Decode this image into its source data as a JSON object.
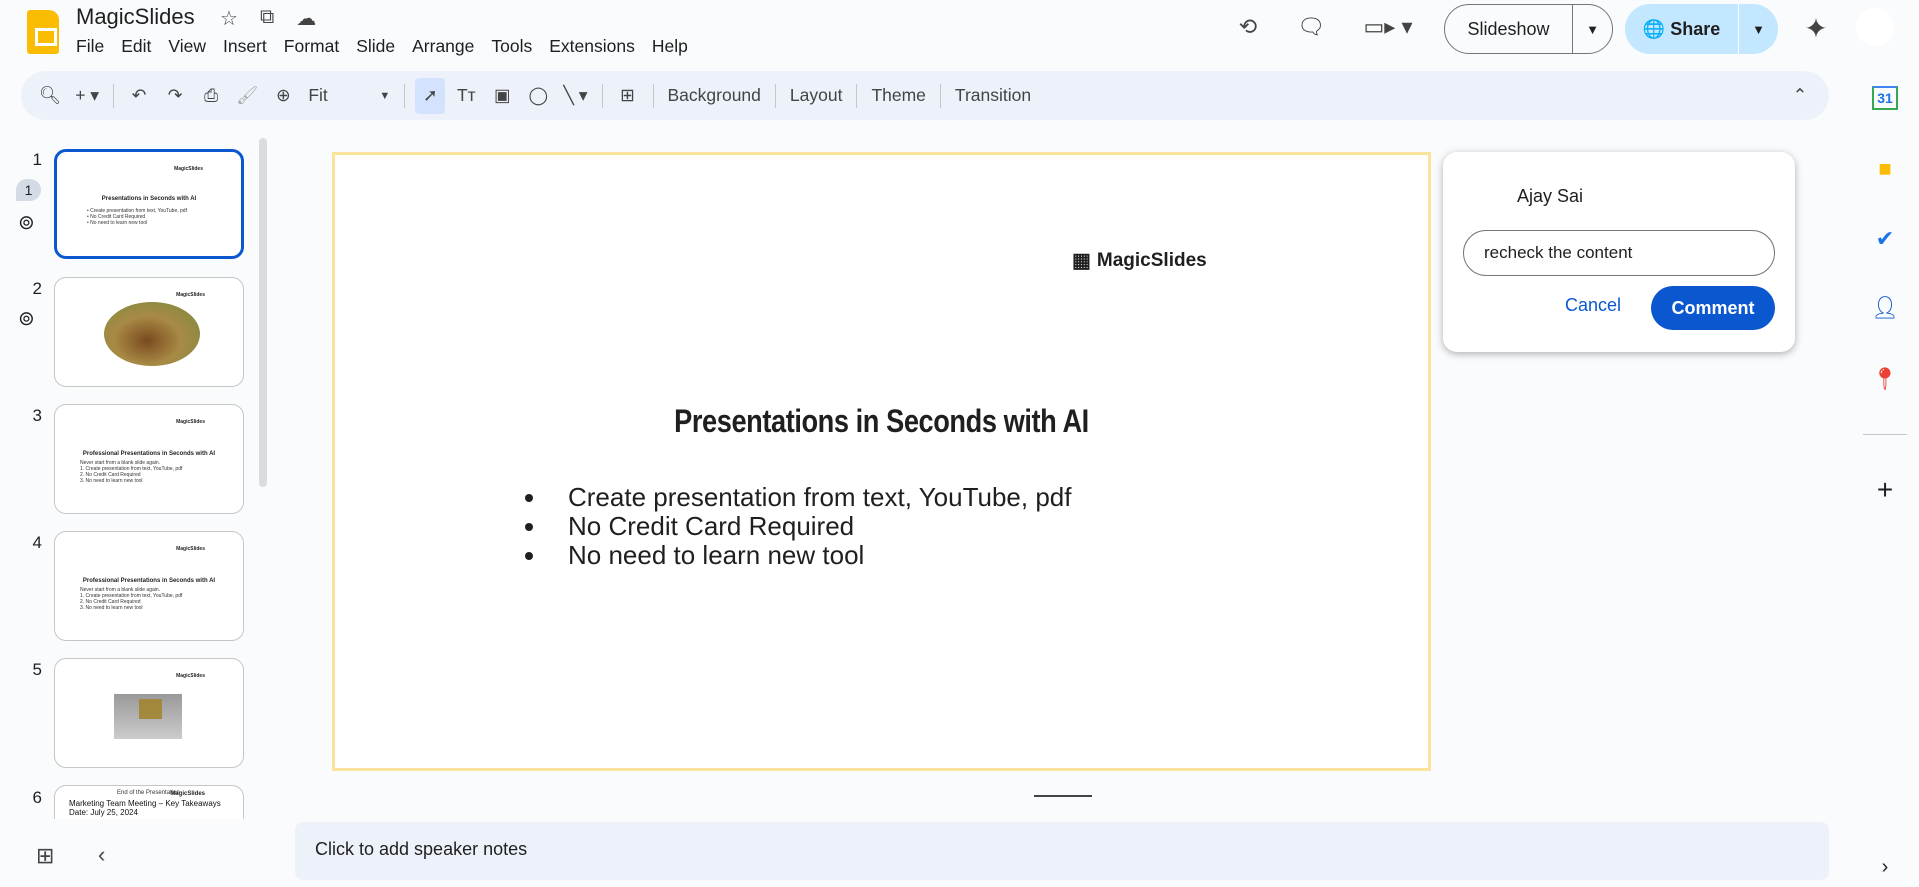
{
  "app": {
    "title": "MagicSlides",
    "menu": [
      "File",
      "Edit",
      "View",
      "Insert",
      "Format",
      "Slide",
      "Arrange",
      "Tools",
      "Extensions",
      "Help"
    ]
  },
  "header": {
    "slideshow_label": "Slideshow",
    "share_label": "Share"
  },
  "toolbar": {
    "zoom_value": "Fit",
    "background": "Background",
    "layout": "Layout",
    "theme": "Theme",
    "transition": "Transition"
  },
  "filmstrip": {
    "slides": [
      {
        "number": "1",
        "comment_count": "1",
        "logo": "MagicSlides",
        "title": "Presentations in Seconds with AI",
        "lines": [
          "• Create presentation from text, YouTube, pdf",
          "• No Credit Card Required",
          "• No need to learn new tool"
        ]
      },
      {
        "number": "2",
        "logo": "MagicSlides"
      },
      {
        "number": "3",
        "logo": "MagicSlides",
        "title": "Professional Presentations in Seconds with AI",
        "lines": [
          "Never start from a blank slide again.",
          "1. Create presentation from text, YouTube, pdf",
          "2. No Credit Card Required",
          "3. No need to learn new tool"
        ]
      },
      {
        "number": "4",
        "logo": "MagicSlides",
        "title": "Professional Presentations in Seconds with AI",
        "lines": [
          "Never start from a blank slide again.",
          "1. Create presentation from text, YouTube, pdf",
          "2. No Credit Card Required",
          "3. No need to learn new tool"
        ]
      },
      {
        "number": "5",
        "logo": "MagicSlides"
      },
      {
        "number": "6",
        "logo": "MagicSlides",
        "title": "End of the Presentation",
        "lines": [
          "Marketing Team Meeting – Key Takeaways",
          "Date: July 25, 2024"
        ]
      }
    ]
  },
  "slide": {
    "logo": "MagicSlides",
    "title": "Presentations in Seconds with AI",
    "bullets": [
      "Create presentation from text, YouTube, pdf",
      "No Credit Card Required",
      "No need to learn new tool"
    ]
  },
  "notes": {
    "placeholder": "Click to add speaker notes"
  },
  "comment": {
    "author": "Ajay Sai",
    "input_value": "recheck the content",
    "cancel": "Cancel",
    "submit": "Comment"
  },
  "colors": {
    "accent": "#0b57d0",
    "share_bg": "#c2e7ff",
    "slide_border": "#fbe39c"
  }
}
